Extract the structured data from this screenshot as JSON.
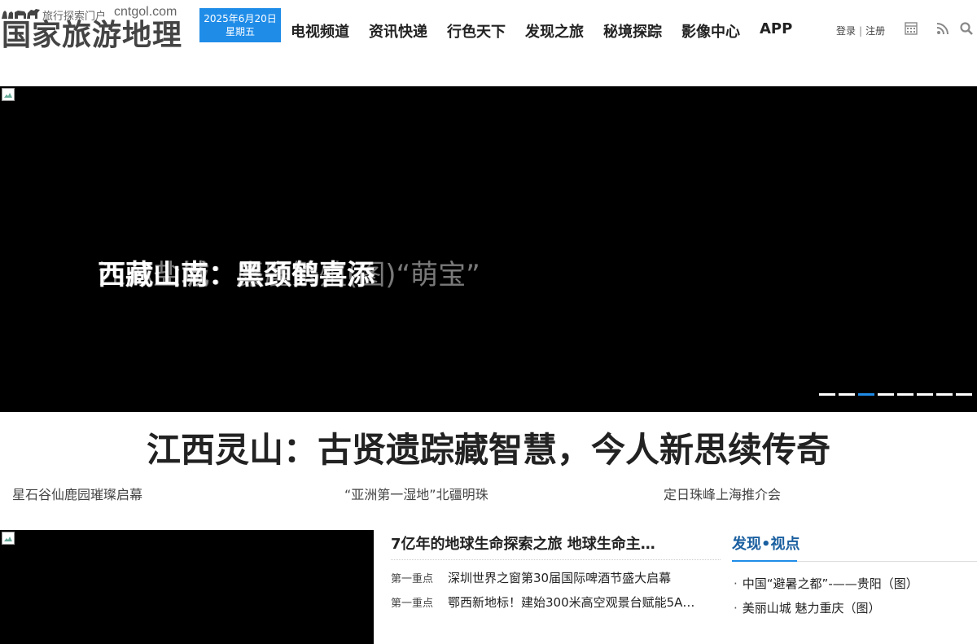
{
  "logo": {
    "tagline": "旅行探索门户",
    "domain": "cntgol.com",
    "name": "国家旅游地理"
  },
  "date": {
    "line1": "2025年6月20日",
    "line2": "星期五",
    "accent": "#1f8ce8"
  },
  "nav": [
    "电视频道",
    "资讯快递",
    "行色天下",
    "发现之旅",
    "秘境探踪",
    "影像中心",
    "APP"
  ],
  "user": {
    "login": "登录",
    "separator": "|",
    "register": "注册"
  },
  "tools": [
    "calendar-icon",
    "rss-icon",
    "search-icon"
  ],
  "slider": {
    "caption_a": "西藏山南：黑颈鹤喜添",
    "caption_b": "江苏盐城：麋鹿繁殖(图)“萌宝”",
    "caption_c": "西藏山城：黑颈鹤喜添",
    "dot_count": 8,
    "active_dot": 3
  },
  "headline": "江西灵山：古贤遗踪藏智慧，今人新思续传奇",
  "sub_links": [
    "星石谷仙鹿园璀璨启幕",
    "“亚洲第一湿地”北疆明珠",
    "定日珠峰上海推介会"
  ],
  "news": {
    "title": "7亿年的地球生命探索之旅 地球生命主…",
    "items": [
      {
        "tag": "第一重点",
        "text": "深圳世界之窗第30届国际啤酒节盛大启幕"
      },
      {
        "tag": "第一重点",
        "text": "鄂西新地标！建始300米高空观景台赋能5A…"
      }
    ]
  },
  "side": {
    "title": "发现•视点",
    "items": [
      "中国“避暑之都”-——贵阳（图）",
      "美丽山城 魅力重庆（图）"
    ]
  }
}
